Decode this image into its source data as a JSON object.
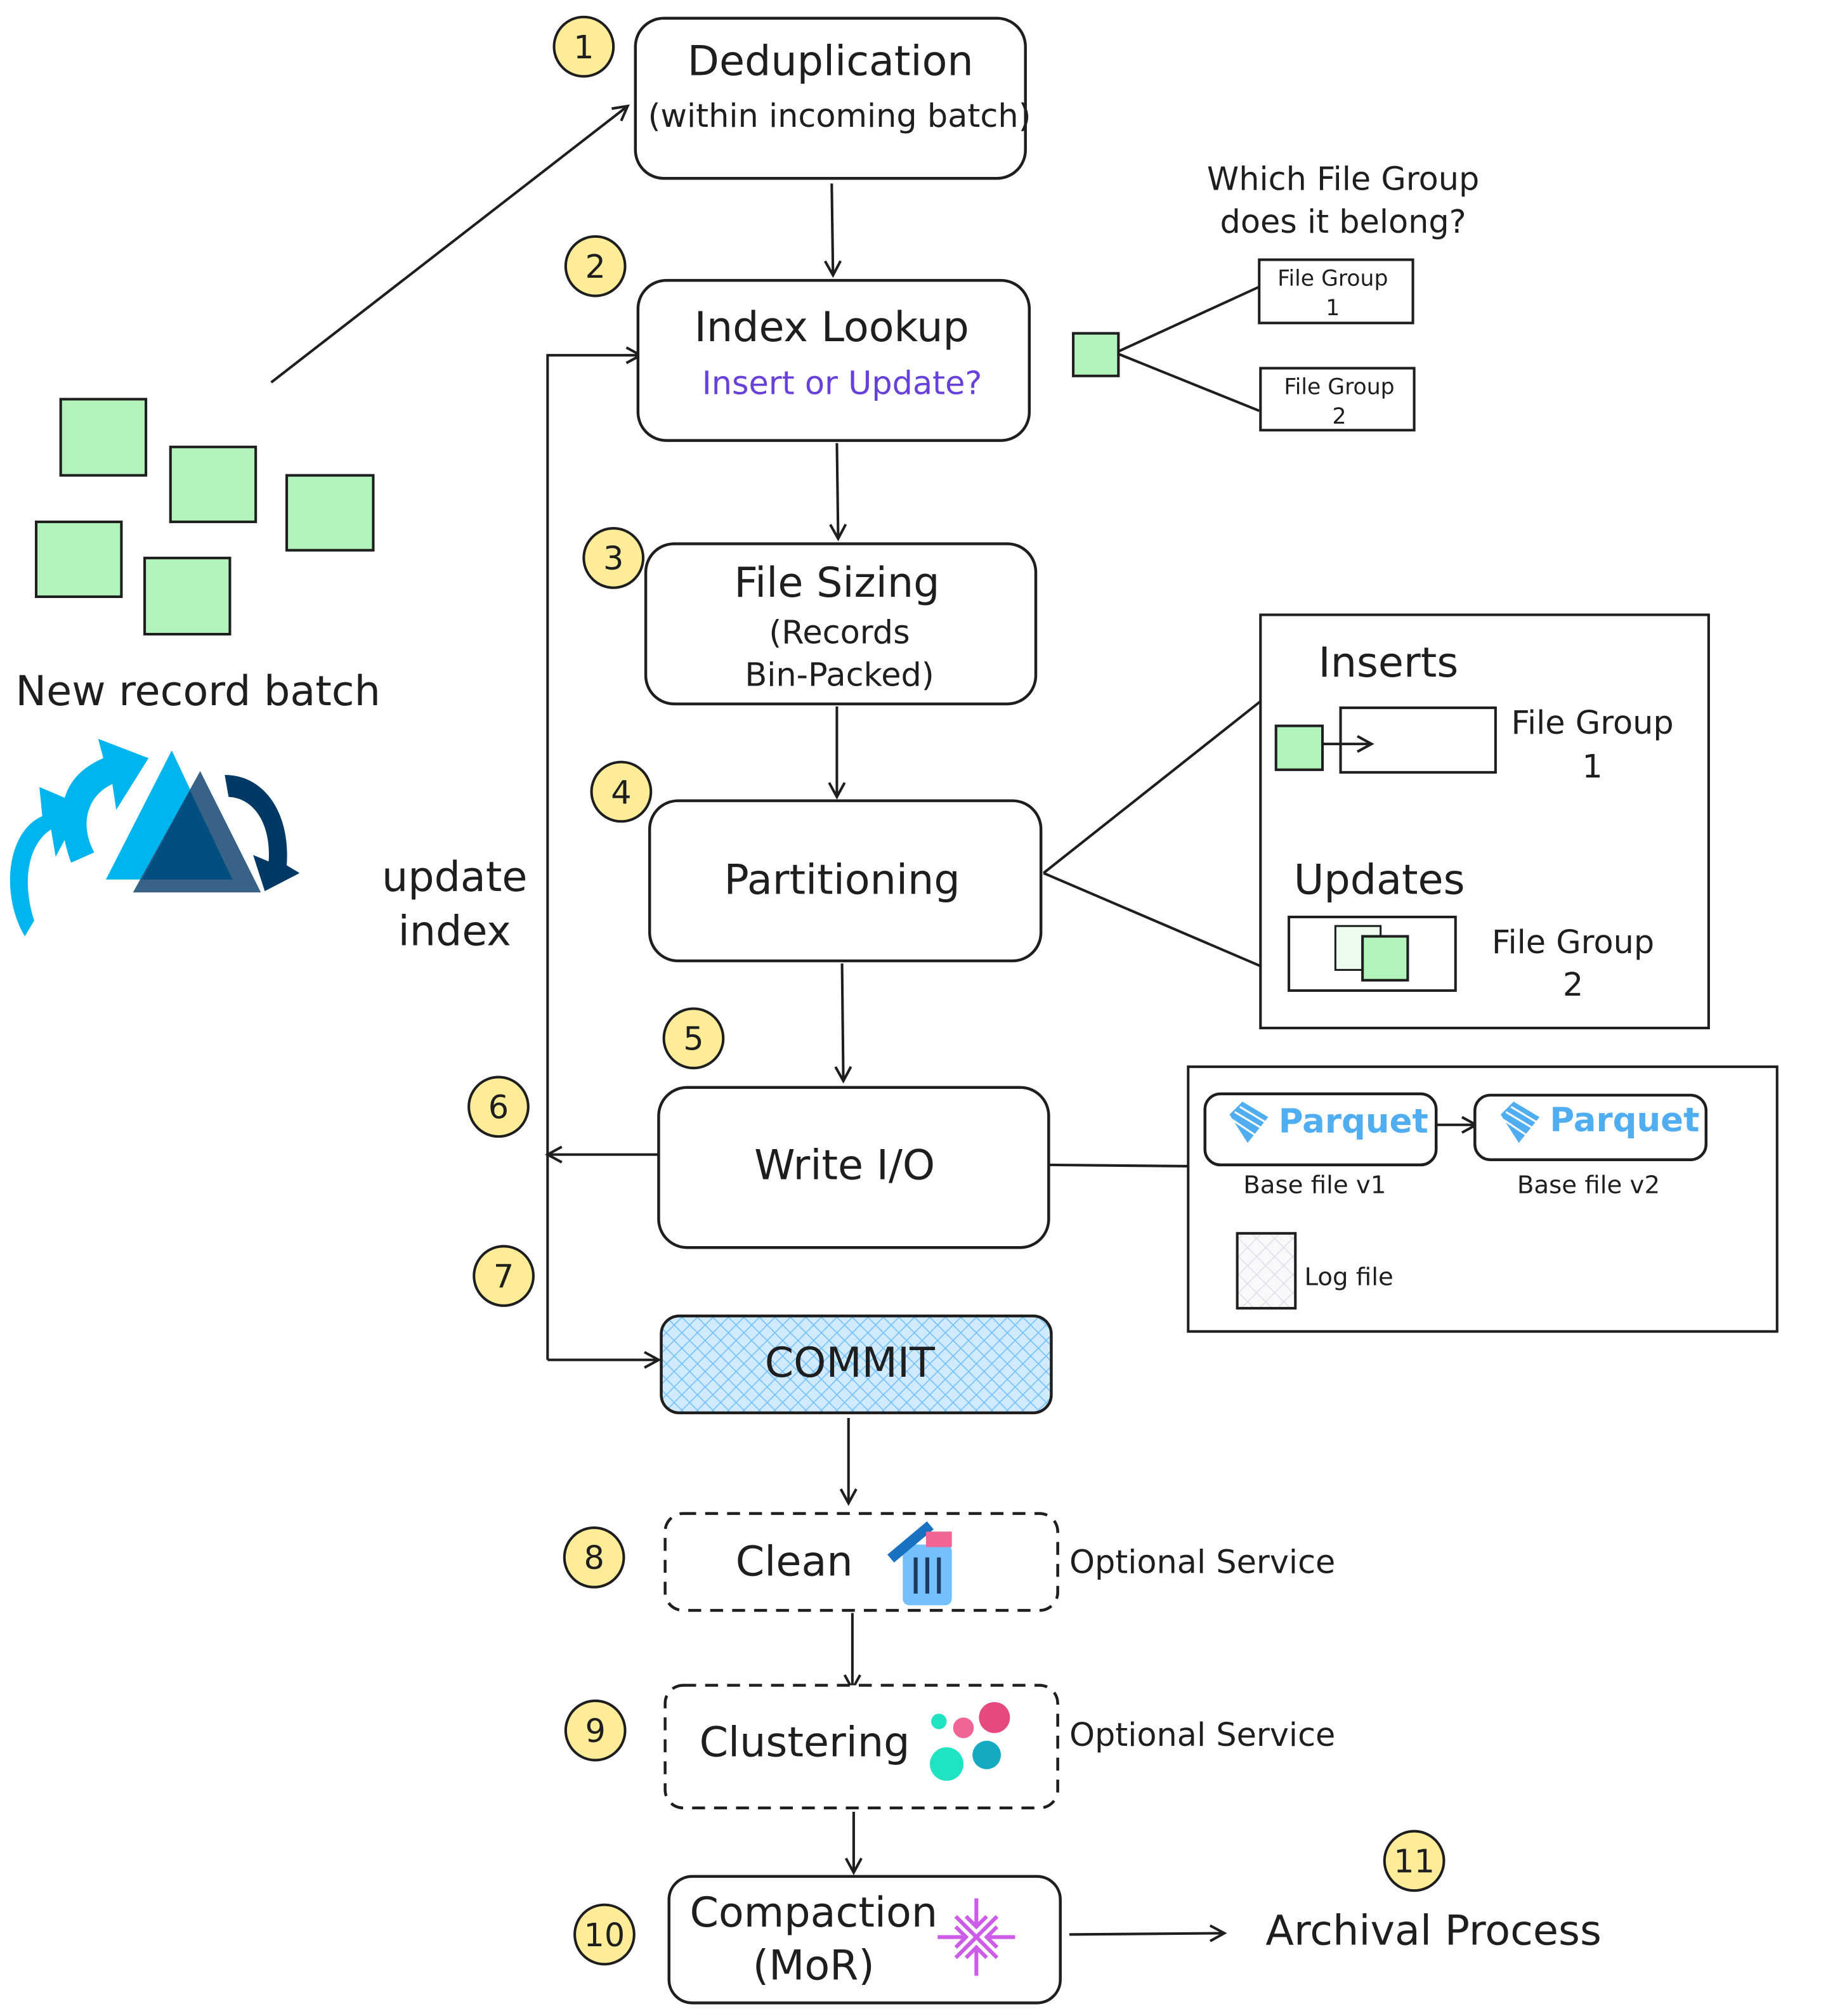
{
  "steps": [
    {
      "num": "1",
      "title": "Deduplication",
      "sub": "(within incoming batch)"
    },
    {
      "num": "2",
      "title": "Index Lookup",
      "sub": "Insert or Update?"
    },
    {
      "num": "3",
      "title": "File Sizing",
      "sub1": "(Records",
      "sub2": "Bin-Packed)"
    },
    {
      "num": "4",
      "title": "Partitioning"
    },
    {
      "num": "5"
    },
    {
      "num": "6",
      "title": "Write I/O"
    },
    {
      "num": "7",
      "title": "COMMIT"
    },
    {
      "num": "8",
      "title": "Clean",
      "note": "Optional Service"
    },
    {
      "num": "9",
      "title": "Clustering",
      "note": "Optional Service"
    },
    {
      "num": "10",
      "title1": "Compaction",
      "title2": "(MoR)"
    },
    {
      "num": "11",
      "title": "Archival Process"
    }
  ],
  "batch_label": "New record batch",
  "update_index": {
    "line1": "update",
    "line2": "index"
  },
  "lookup": {
    "question1": "Which File Group",
    "question2": "does it belong?",
    "fg1": {
      "line1": "File Group",
      "line2": "1"
    },
    "fg2": {
      "line1": "File Group",
      "line2": "2"
    }
  },
  "partition_panel": {
    "inserts": "Inserts",
    "updates": "Updates",
    "fg1": {
      "line1": "File Group",
      "line2": "1"
    },
    "fg2": {
      "line1": "File Group",
      "line2": "2"
    }
  },
  "write_panel": {
    "parquet": "Parquet",
    "base_v1": "Base file v1",
    "base_v2": "Base file v2",
    "log_file": "Log file"
  },
  "colors": {
    "record": "#b2f2bb",
    "step_badge": "#ffec99",
    "accent_text": "#6741d9",
    "parquet": "#50aef0",
    "commit_fill": "#d0ebff"
  },
  "icons": [
    "hudi-logo",
    "trash-icon",
    "clustering-dots-icon",
    "compaction-icon",
    "parquet-logo"
  ]
}
